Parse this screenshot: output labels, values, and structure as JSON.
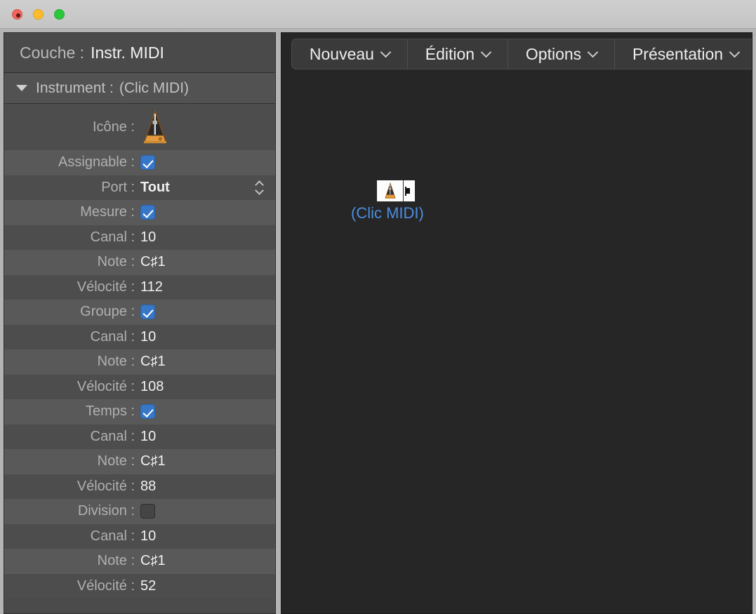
{
  "window": {
    "traffic_lights": [
      "close",
      "minimize",
      "zoom"
    ]
  },
  "inspector": {
    "layer": {
      "label": "Couche :",
      "value": "Instr. MIDI"
    },
    "section": {
      "label": "Instrument :",
      "value": "(Clic MIDI)",
      "expanded": true
    },
    "rows": [
      {
        "label": "Icône :",
        "type": "icon"
      },
      {
        "label": "Assignable :",
        "type": "checkbox",
        "checked": true
      },
      {
        "label": "Port :",
        "type": "popup",
        "value": "Tout"
      },
      {
        "label": "Mesure :",
        "type": "checkbox",
        "checked": true
      },
      {
        "label": "Canal :",
        "type": "text",
        "value": "10"
      },
      {
        "label": "Note :",
        "type": "text",
        "value": "C♯1"
      },
      {
        "label": "Vélocité :",
        "type": "text",
        "value": "112"
      },
      {
        "label": "Groupe :",
        "type": "checkbox",
        "checked": true
      },
      {
        "label": "Canal :",
        "type": "text",
        "value": "10"
      },
      {
        "label": "Note :",
        "type": "text",
        "value": "C♯1"
      },
      {
        "label": "Vélocité :",
        "type": "text",
        "value": "108"
      },
      {
        "label": "Temps :",
        "type": "checkbox",
        "checked": true
      },
      {
        "label": "Canal :",
        "type": "text",
        "value": "10"
      },
      {
        "label": "Note :",
        "type": "text",
        "value": "C♯1"
      },
      {
        "label": "Vélocité :",
        "type": "text",
        "value": "88"
      },
      {
        "label": "Division :",
        "type": "checkbox",
        "checked": false
      },
      {
        "label": "Canal :",
        "type": "text",
        "value": "10"
      },
      {
        "label": "Note :",
        "type": "text",
        "value": "C♯1"
      },
      {
        "label": "Vélocité :",
        "type": "text",
        "value": "52"
      }
    ]
  },
  "menubar": {
    "items": [
      {
        "label": "Nouveau"
      },
      {
        "label": "Édition"
      },
      {
        "label": "Options"
      },
      {
        "label": "Présentation"
      }
    ]
  },
  "canvas": {
    "objects": [
      {
        "label": "(Clic MIDI)",
        "icon": "metronome-icon",
        "label_color": "#4b8ee0"
      }
    ]
  },
  "colors": {
    "titlebar": "#c9c9c9",
    "inspector_bg": "#4b4b4b",
    "row_dark": "#4d4d4d",
    "row_light": "#595959",
    "canvas_bg": "#262626",
    "checkbox_blue": "#3777c8",
    "object_label": "#4b8ee0"
  }
}
